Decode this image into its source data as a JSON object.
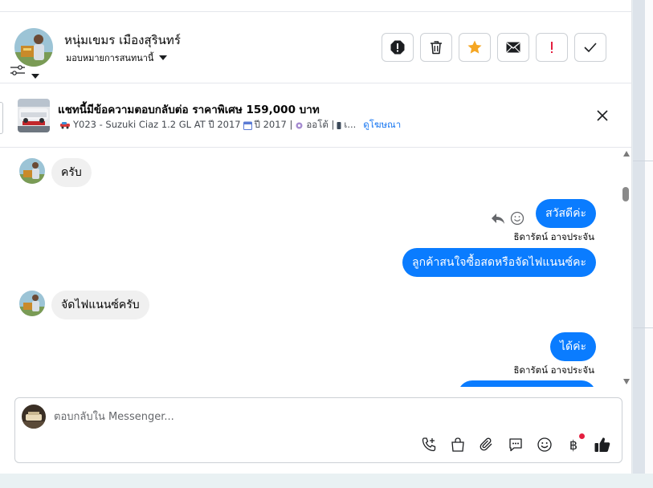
{
  "header": {
    "contact_name": "หนุ่มเขมร เมืองสุรินทร์",
    "assign_label": "มอบหมายการสนทนานี้"
  },
  "ad": {
    "title": "แชทนี้มีข้อความตอบกลับต่อ ราคาพิเศษ 159,000 บาท",
    "meta": "Y023 - Suzuki Ciaz 1.2 GL AT ปี 2017",
    "meta_year": "ปี 2017 |",
    "meta_trans": "ออโต้ |",
    "meta_more": "เ...",
    "view_ad_link": "ดูโฆษณา"
  },
  "messages": [
    {
      "direction": "in",
      "text": "ครับ"
    },
    {
      "direction": "out",
      "text": "สวัสดีค่ะ"
    },
    {
      "sender": "ธิดารัตน์ อาจประจัน"
    },
    {
      "direction": "out",
      "text": "ลูกค้าสนใจซื้อสดหรือจัดไฟแนนซ์คะ"
    },
    {
      "direction": "in",
      "text": "จัดไฟแนนซ์ครับ"
    },
    {
      "direction": "out",
      "text": "ได้ค่ะ"
    },
    {
      "sender": "ธิดารัตน์ อาจประจัน"
    }
  ],
  "composer": {
    "placeholder": "ตอบกลับใน Messenger...",
    "baht_symbol": "฿"
  },
  "colors": {
    "outgoing_bubble": "#0a7cff",
    "incoming_bubble": "#f0f0f0",
    "star": "#f5a623",
    "alert_red": "#e41e3f",
    "link": "#1877f2"
  },
  "icons": [
    "filter-icon",
    "chevron-down-icon",
    "report-icon",
    "trash-icon",
    "star-icon",
    "envelope-icon",
    "exclamation-icon",
    "check-icon",
    "close-icon",
    "reply-icon",
    "emoji-icon",
    "phone-plus-icon",
    "shopping-bag-icon",
    "paperclip-icon",
    "chat-bubble-icon",
    "smiley-icon",
    "baht-icon",
    "thumbs-up-icon"
  ]
}
